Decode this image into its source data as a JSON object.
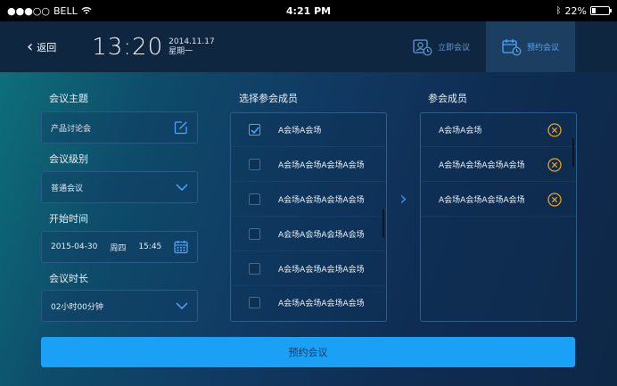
{
  "status_bar": {
    "carrier": "BELL",
    "time": "4:21 PM",
    "battery": "22%",
    "battery_level": 0.22
  },
  "header": {
    "back_label": "返回",
    "clock_time": "13:20",
    "clock_date": "2014.11.17",
    "clock_weekday": "星期一",
    "tabs": [
      {
        "label": "立即会议",
        "icon": "instant-meeting-icon",
        "active": false
      },
      {
        "label": "预约会议",
        "icon": "calendar-clock-icon",
        "active": true
      }
    ]
  },
  "form": {
    "topic_label": "会议主题",
    "topic_value": "产品讨论会",
    "level_label": "会议级别",
    "level_value": "普通会议",
    "start_label": "开始时间",
    "start_date": "2015-04-30",
    "start_weekday": "周四",
    "start_time": "15:45",
    "duration_label": "会议时长",
    "duration_value": "02小时00分钟"
  },
  "select_members": {
    "title": "选择参会成员",
    "items": [
      {
        "name": "A会场A会场",
        "checked": true
      },
      {
        "name": "A会场A会场A会场A会场",
        "checked": false
      },
      {
        "name": "A会场A会场A会场A会场",
        "checked": false
      },
      {
        "name": "A会场A会场A会场A会场",
        "checked": false
      },
      {
        "name": "A会场A会场A会场A会场",
        "checked": false
      },
      {
        "name": "A会场A会场A会场A会场",
        "checked": false
      }
    ]
  },
  "attendees": {
    "title": "参会成员",
    "items": [
      {
        "name": "A会场A会场"
      },
      {
        "name": "A会场A会场A会场A会场"
      },
      {
        "name": "A会场A会场A会场A会场"
      }
    ]
  },
  "submit_label": "预约会议",
  "colors": {
    "accent": "#1aa0f5",
    "remove": "#e8a31c",
    "border": "#2d5e8a"
  }
}
